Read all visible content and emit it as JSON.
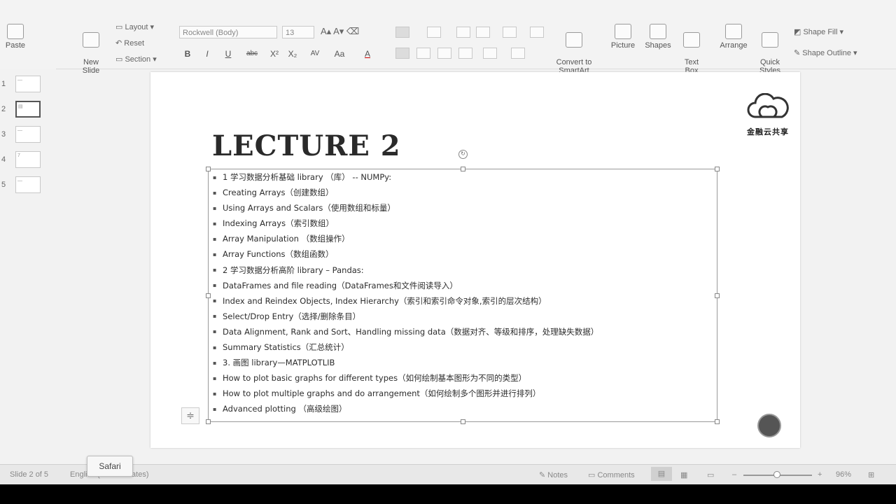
{
  "ribbon": {
    "paste": "Paste",
    "new_slide": "New\nSlide",
    "layout": "Layout",
    "reset": "Reset",
    "section": "Section",
    "font_name": "Rockwell (Body)",
    "font_size": "13",
    "convert_smartart": "Convert to\nSmartArt",
    "picture": "Picture",
    "shapes": "Shapes",
    "text_box": "Text\nBox",
    "arrange": "Arrange",
    "quick_styles": "Quick\nStyles",
    "shape_fill": "Shape Fill",
    "shape_outline": "Shape Outline"
  },
  "thumbnails": [
    {
      "num": "1",
      "hint": "—"
    },
    {
      "num": "2",
      "hint": "▤"
    },
    {
      "num": "3",
      "hint": "—"
    },
    {
      "num": "4",
      "hint": "7"
    },
    {
      "num": "5",
      "hint": "—"
    }
  ],
  "slide": {
    "title": "LECTURE 2",
    "logo_text": "金融云共享",
    "bullets": [
      "1 学习数据分析基础 library （库） -- NUMPy:",
      "Creating Arrays（创建数组）",
      "Using Arrays and Scalars（使用数组和标量）",
      "Indexing Arrays（索引数组）",
      "Array Manipulation （数组操作）",
      "Array Functions（数组函数）",
      "2 学习数据分析高阶 library – Pandas:",
      "DataFrames and file reading（DataFrames和文件阅读导入）",
      "Index and Reindex Objects, Index Hierarchy（索引和索引命令对象,索引的层次结构）",
      "Select/Drop Entry（选择/删除条目）",
      "Data Alignment, Rank and Sort、Handling missing data（数据对齐、等级和排序，处理缺失数据）",
      "Summary Statistics（汇总统计）",
      "3. 画图 library—MATPLOTLIB",
      "How to plot basic graphs for different types（如何绘制基本图形为不同的类型）",
      "How to plot multiple graphs and do arrangement（如何绘制多个图形并进行排列）",
      "Advanced plotting （高级绘图）"
    ]
  },
  "status": {
    "slide_of": "Slide 2 of 5",
    "language": "English (United States)",
    "notes": "Notes",
    "comments": "Comments",
    "zoom": "96%",
    "tooltip": "Safari"
  }
}
